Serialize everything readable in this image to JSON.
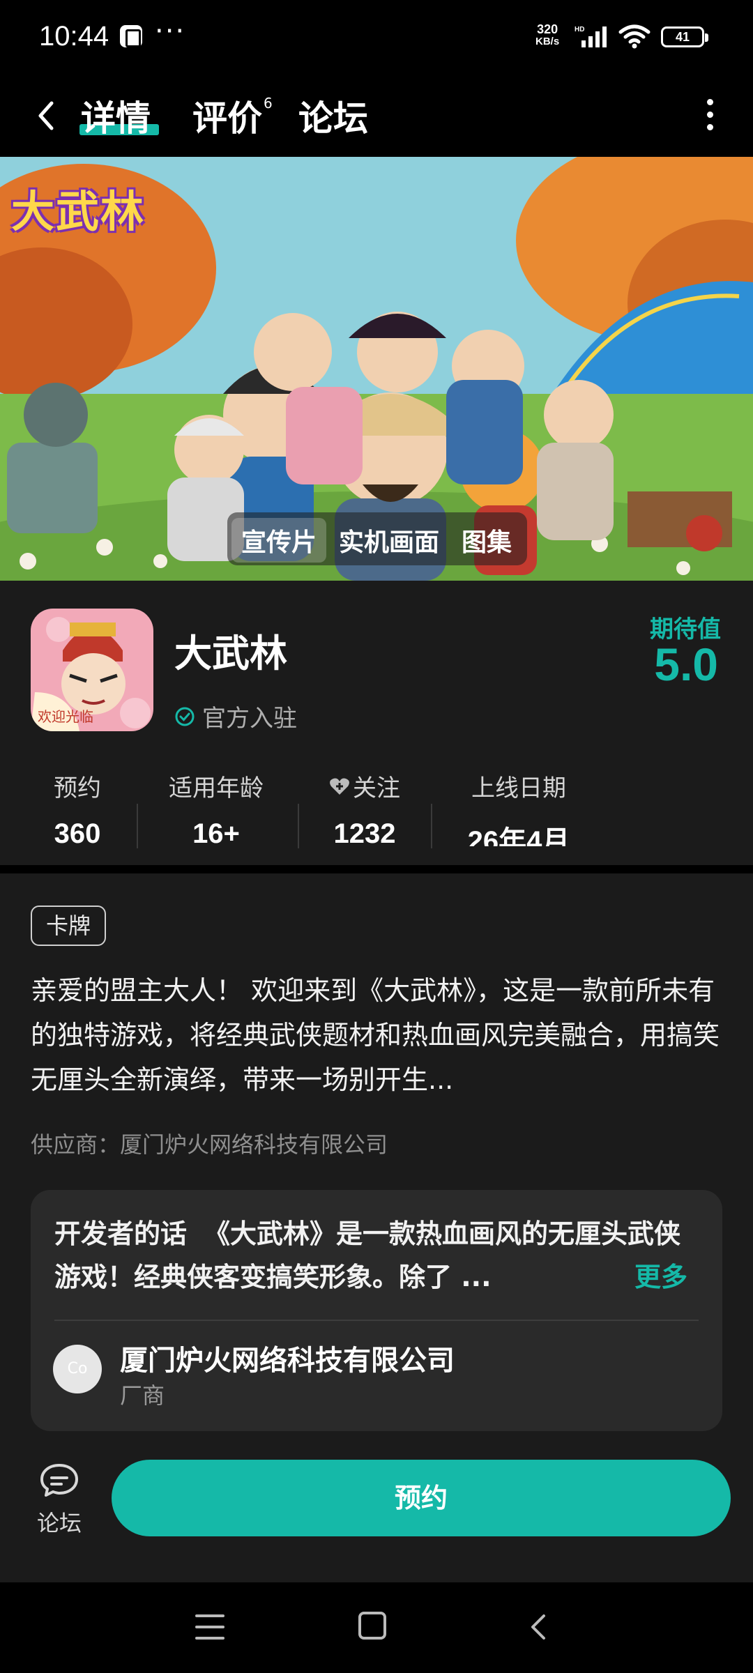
{
  "status_bar": {
    "time": "10:44",
    "dots": "···",
    "net_speed_value": "320",
    "net_speed_unit": "KB/s",
    "hd": "HD",
    "battery": "41"
  },
  "header": {
    "tabs": [
      {
        "label": "详情",
        "active": true
      },
      {
        "label": "评价",
        "badge": "6"
      },
      {
        "label": "论坛"
      }
    ]
  },
  "banner": {
    "logo_text": "大武林",
    "media_tabs": [
      "宣传片",
      "实机画面",
      "图集"
    ]
  },
  "app": {
    "name": "大武林",
    "verified_label": "官方入驻",
    "expect_label": "期待值",
    "expect_value": "5.0",
    "icon_caption": "欢迎光临"
  },
  "stats": [
    {
      "label": "预约",
      "value": "360"
    },
    {
      "label": "适用年龄",
      "value": "16+"
    },
    {
      "label": "关注",
      "value": "1232",
      "icon": "heart-plus-icon"
    },
    {
      "label": "上线日期",
      "value": "26年4月"
    }
  ],
  "description": {
    "tag": "卡牌",
    "text": "亲爱的盟主大人！ 欢迎来到《大武林》，这是一款前所未有的独特游戏，将经典武侠题材和热血画风完美融合，用搞笑无厘头全新演绎，带来一场别开生...",
    "supplier": "供应商：厦门炉火网络科技有限公司"
  },
  "developer": {
    "title": "开发者的话",
    "text": "《大武林》是一款热血画风的无厘头武侠游戏！经典侠客变搞笑形象。除了 ...",
    "more": "更多",
    "avatar_text": "Co",
    "company": "厦门炉火网络科技有限公司",
    "role": "厂商"
  },
  "actions": {
    "forum_label": "论坛",
    "reserve_label": "预约"
  },
  "colors": {
    "accent": "#15b9a8",
    "background": "#1b1b1b"
  }
}
